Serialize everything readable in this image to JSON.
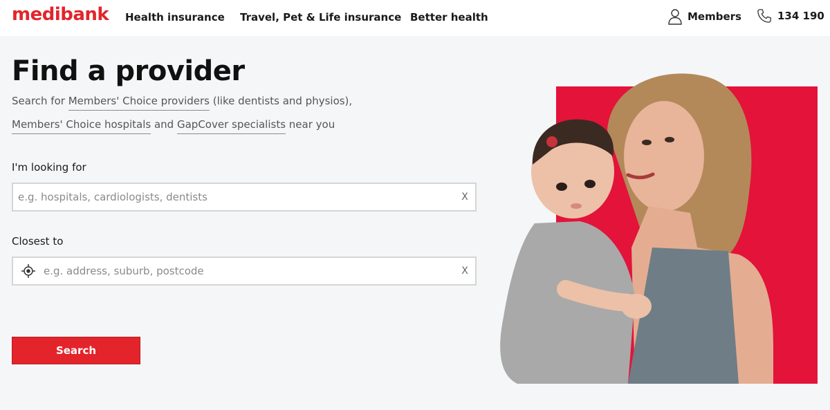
{
  "header": {
    "logo": "medibank",
    "nav": [
      "Health insurance",
      "Travel, Pet & Life insurance",
      "Better health"
    ],
    "members_label": "Members",
    "phone_label": "134 190"
  },
  "main": {
    "title": "Find a provider",
    "intro": {
      "line1_prefix": "Search for ",
      "link_providers": "Members' Choice providers",
      "line1_suffix": " (like dentists and physios),",
      "link_hospitals": "Members' Choice hospitals",
      "line2_middle": " and ",
      "link_gapcover": "GapCover specialists",
      "line2_suffix": " near you"
    },
    "looking_for": {
      "label": "I'm looking for",
      "placeholder": "e.g. hospitals, cardiologists, dentists",
      "value": "",
      "clear_label": "X"
    },
    "closest_to": {
      "label": "Closest to",
      "placeholder": "e.g. address, suburb, postcode",
      "value": "",
      "clear_label": "X"
    },
    "search_button": "Search"
  },
  "icons": {
    "members": "person-icon",
    "phone": "phone-icon",
    "locate": "crosshair-icon"
  },
  "colors": {
    "brand_red": "#e3242b",
    "background": "#f5f6f8",
    "text": "#1a1a1a"
  }
}
